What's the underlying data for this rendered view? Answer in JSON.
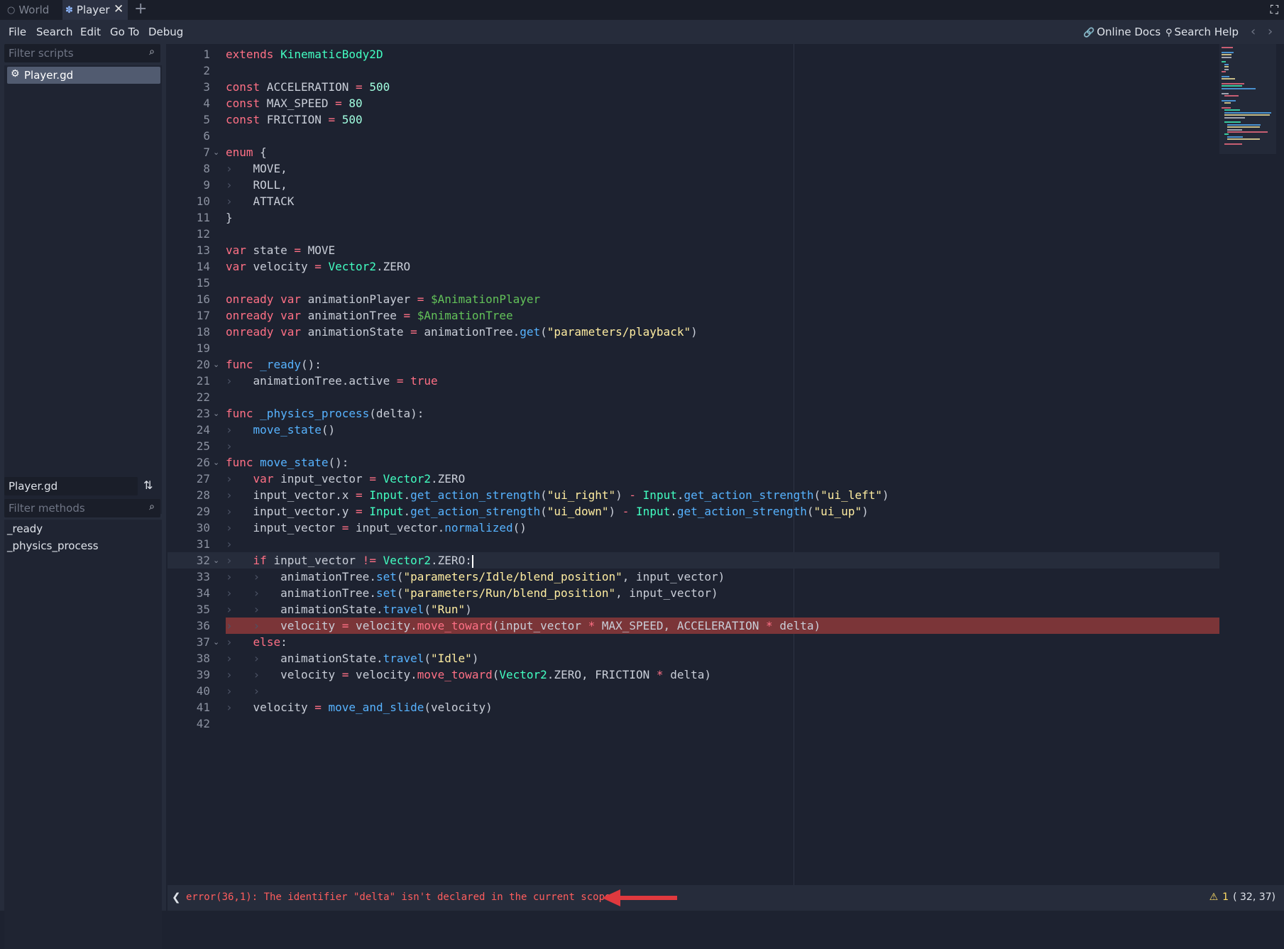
{
  "tabs": [
    {
      "label": "World",
      "icon": "circle-icon",
      "active": false
    },
    {
      "label": "Player",
      "icon": "player-node-icon",
      "active": true
    }
  ],
  "menu": [
    "File",
    "Search",
    "Edit",
    "Go To",
    "Debug"
  ],
  "help": {
    "online_docs": "Online Docs",
    "search_help": "Search Help"
  },
  "scripts": {
    "filter_placeholder": "Filter scripts",
    "items": [
      {
        "name": "Player.gd",
        "icon": "gear-icon"
      }
    ]
  },
  "methods_panel": {
    "script_name": "Player.gd",
    "filter_placeholder": "Filter methods",
    "items": [
      "_ready",
      "_physics_process"
    ]
  },
  "editor": {
    "current_line": 32,
    "error_line": 36,
    "line_numbers": [
      "1",
      "2",
      "3",
      "4",
      "5",
      "6",
      "7",
      "8",
      "9",
      "10",
      "11",
      "12",
      "13",
      "14",
      "15",
      "16",
      "17",
      "18",
      "19",
      "20",
      "21",
      "22",
      "23",
      "24",
      "25",
      "26",
      "27",
      "28",
      "29",
      "30",
      "31",
      "32",
      "33",
      "34",
      "35",
      "36",
      "37",
      "38",
      "39",
      "40",
      "41",
      "42"
    ],
    "folded_lines": [
      7,
      20,
      23,
      26,
      32,
      37
    ],
    "lines": [
      "extends KinematicBody2D",
      "",
      "const ACCELERATION = 500",
      "const MAX_SPEED = 80",
      "const FRICTION = 500",
      "",
      "enum {",
      "\tMOVE,",
      "\tROLL,",
      "\tATTACK",
      "}",
      "",
      "var state = MOVE",
      "var velocity = Vector2.ZERO",
      "",
      "onready var animationPlayer = $AnimationPlayer",
      "onready var animationTree = $AnimationTree",
      "onready var animationState = animationTree.get(\"parameters/playback\")",
      "",
      "func _ready():",
      "\tanimationTree.active = true",
      "",
      "func _physics_process(delta):",
      "\tmove_state()",
      "\t",
      "func move_state():",
      "\tvar input_vector = Vector2.ZERO",
      "\tinput_vector.x = Input.get_action_strength(\"ui_right\") - Input.get_action_strength(\"ui_left\")",
      "\tinput_vector.y = Input.get_action_strength(\"ui_down\") - Input.get_action_strength(\"ui_up\")",
      "\tinput_vector = input_vector.normalized()",
      "\t",
      "\tif input_vector != Vector2.ZERO:",
      "\t\tanimationTree.set(\"parameters/Idle/blend_position\", input_vector)",
      "\t\tanimationTree.set(\"parameters/Run/blend_position\", input_vector)",
      "\t\tanimationState.travel(\"Run\")",
      "\t\tvelocity = velocity.move_toward(input_vector * MAX_SPEED, ACCELERATION * delta)",
      "\telse:",
      "\t\tanimationState.travel(\"Idle\")",
      "\t\tvelocity = velocity.move_toward(Vector2.ZERO, FRICTION * delta)",
      "\t\t",
      "\tvelocity = move_and_slide(velocity)",
      ""
    ]
  },
  "status": {
    "error_text": "error(36,1): The identifier \"delta\" isn't declared in the current scope.",
    "warning_count": "1",
    "cursor_position": "( 32, 37)"
  },
  "colors": {
    "keyword": "#ff7085",
    "class": "#42ffc2",
    "number": "#a1ffe0",
    "string": "#ffeda1",
    "function": "#57b3ff",
    "node_path": "#63c259",
    "error_line_bg": "#7b3538",
    "error_text": "#ff5d5d",
    "annotation_arrow": "#e0393e"
  }
}
